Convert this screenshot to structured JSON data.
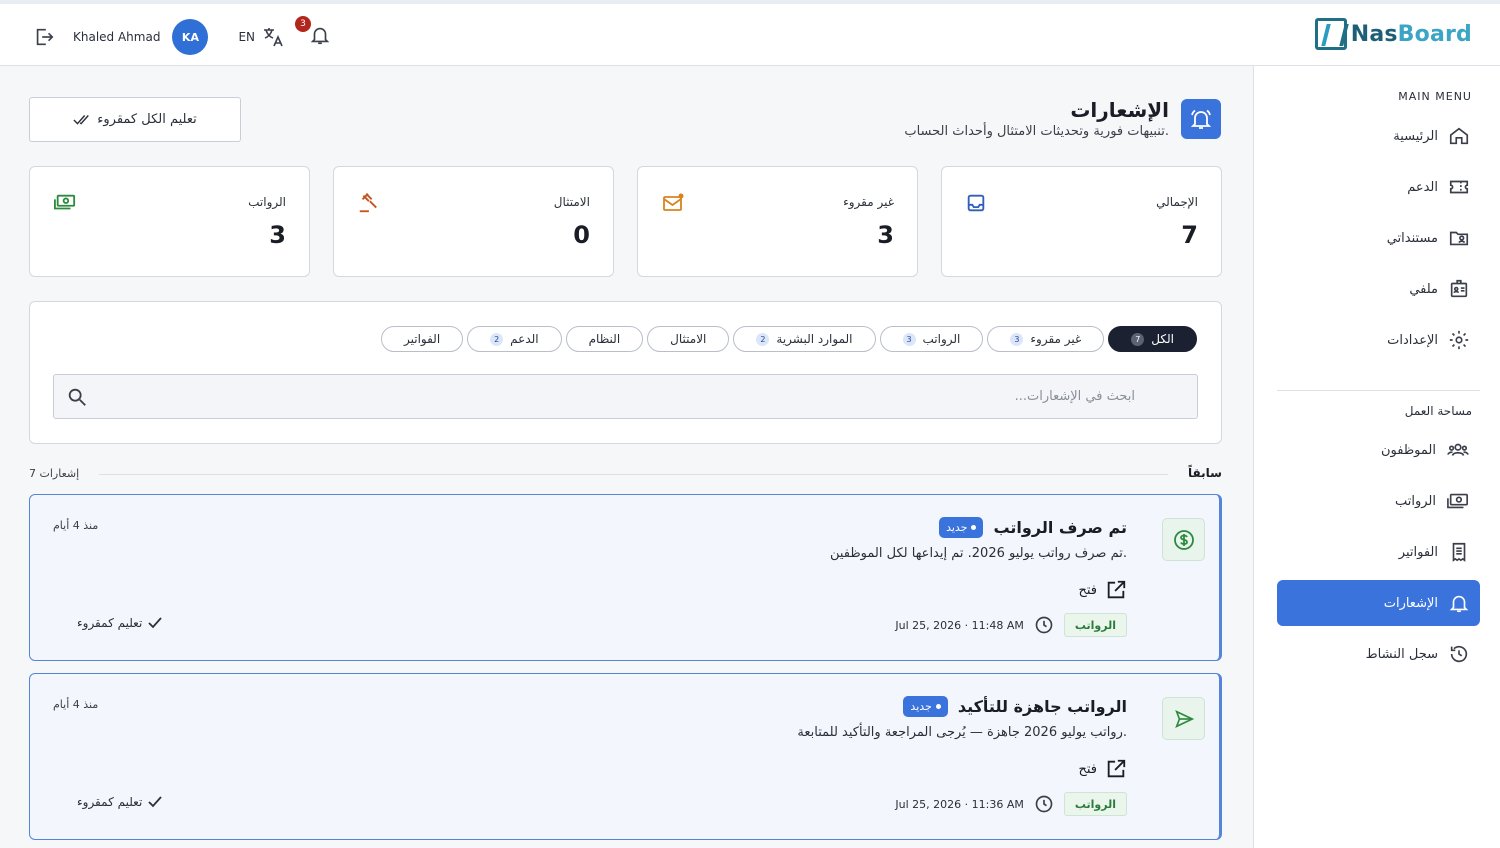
{
  "topbar": {
    "user_name": "Khaled Ahmad",
    "avatar_initials": "KA",
    "lang_label": "EN",
    "notif_count": "3",
    "logo_part1": "Nas",
    "logo_part2": "Board"
  },
  "sidebar": {
    "main_menu_label": "MAIN MENU",
    "workspace_label": "مساحة العمل",
    "items": [
      {
        "label": "الرئيسية",
        "icon": "home-icon"
      },
      {
        "label": "الدعم",
        "icon": "ticket-icon"
      },
      {
        "label": "مستنداتي",
        "icon": "folder-user-icon"
      },
      {
        "label": "ملفي",
        "icon": "id-card-icon"
      },
      {
        "label": "الإعدادات",
        "icon": "gear-icon"
      }
    ],
    "workspace_items": [
      {
        "label": "الموظفون",
        "icon": "people-icon"
      },
      {
        "label": "الرواتب",
        "icon": "money-icon"
      },
      {
        "label": "الفواتير",
        "icon": "receipt-icon"
      },
      {
        "label": "الإشعارات",
        "icon": "bell-icon",
        "active": true
      },
      {
        "label": "سجل النشاط",
        "icon": "history-icon"
      }
    ]
  },
  "header": {
    "title": "الإشعارات",
    "subtitle": "تنبيهات فورية وتحديثات الامتثال وأحداث الحساب.",
    "mark_all_label": "تعليم الكل كمقروء"
  },
  "stats": [
    {
      "label": "الإجمالي",
      "value": "7",
      "icon": "inbox-icon",
      "color": "#2f5fb8"
    },
    {
      "label": "غير مقروء",
      "value": "3",
      "icon": "mail-unread-icon",
      "color": "#d9831f"
    },
    {
      "label": "الامتثال",
      "value": "0",
      "icon": "gavel-icon",
      "color": "#c4541c"
    },
    {
      "label": "الرواتب",
      "value": "3",
      "icon": "money-icon",
      "color": "#2c8a3e"
    }
  ],
  "filters": {
    "chips": [
      {
        "label": "الكل",
        "count": "7",
        "active": true
      },
      {
        "label": "غير مقروء",
        "count": "3"
      },
      {
        "label": "الرواتب",
        "count": "3"
      },
      {
        "label": "الموارد البشرية",
        "count": "2"
      },
      {
        "label": "الامتثال",
        "count": ""
      },
      {
        "label": "النظام",
        "count": ""
      },
      {
        "label": "الدعم",
        "count": "2"
      },
      {
        "label": "الفواتير",
        "count": ""
      }
    ],
    "search_placeholder": "ابحث في الإشعارات..."
  },
  "section": {
    "title": "سابقاً",
    "count_label": "7 إشعارات"
  },
  "notifications": [
    {
      "title": "تم صرف الرواتب",
      "new_label": "جديد",
      "body": "تم صرف رواتب يوليو 2026. تم إيداعها لكل الموظفين.",
      "open_label": "فتح",
      "category": "الرواتب",
      "time": "Jul 25, 2026 · 11:48 AM",
      "ago": "منذ 4 أيام",
      "mark_label": "تعليم كمقروء",
      "icon": "dollar-circle-icon"
    },
    {
      "title": "الرواتب جاهزة للتأكيد",
      "new_label": "جديد",
      "body": "رواتب يوليو 2026 جاهزة — يُرجى المراجعة والتأكيد للمتابعة.",
      "open_label": "فتح",
      "category": "الرواتب",
      "time": "Jul 25, 2026 · 11:36 AM",
      "ago": "منذ 4 أيام",
      "mark_label": "تعليم كمقروء",
      "icon": "send-icon"
    }
  ]
}
